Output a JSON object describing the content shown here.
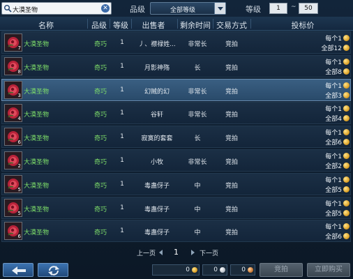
{
  "filters": {
    "search_value": "大漠圣物",
    "grade_label": "品级",
    "grade_value": "全部等级",
    "level_label": "等级",
    "level_min": "1",
    "level_sep": "~",
    "level_max": "50"
  },
  "columns": [
    "名称",
    "品级",
    "等级",
    "出售者",
    "剩余时间",
    "交易方式",
    "投标价"
  ],
  "rows": [
    {
      "qty": "7",
      "name": "大漠圣物",
      "grade": "奇巧",
      "level": "1",
      "seller": "丿、襟禄姓...",
      "time": "非常长",
      "trade": "竞拍",
      "each": "每个1",
      "total": "全部12",
      "selected": false
    },
    {
      "qty": "8",
      "name": "大漠圣物",
      "grade": "奇巧",
      "level": "1",
      "seller": "月影神殇",
      "time": "长",
      "trade": "竞拍",
      "each": "每个1",
      "total": "全部8",
      "selected": false
    },
    {
      "qty": "3",
      "name": "大漠圣物",
      "grade": "奇巧",
      "level": "1",
      "seller": "幻贼的幻",
      "time": "非常长",
      "trade": "竞拍",
      "each": "每个1",
      "total": "全部3",
      "selected": true
    },
    {
      "qty": "4",
      "name": "大漠圣物",
      "grade": "奇巧",
      "level": "1",
      "seller": "谷轩",
      "time": "非常长",
      "trade": "竞拍",
      "each": "每个1",
      "total": "全部4",
      "selected": false
    },
    {
      "qty": "6",
      "name": "大漠圣物",
      "grade": "奇巧",
      "level": "1",
      "seller": "寂寞的套套",
      "time": "长",
      "trade": "竞拍",
      "each": "每个1",
      "total": "全部6",
      "selected": false
    },
    {
      "qty": "2",
      "name": "大漠圣物",
      "grade": "奇巧",
      "level": "1",
      "seller": "小牧",
      "time": "非常长",
      "trade": "竞拍",
      "each": "每个1",
      "total": "全部2",
      "selected": false
    },
    {
      "qty": "5",
      "name": "大漠圣物",
      "grade": "奇巧",
      "level": "1",
      "seller": "毒蛊伢子",
      "time": "中",
      "trade": "竞拍",
      "each": "每个1",
      "total": "全部5",
      "selected": false
    },
    {
      "qty": "5",
      "name": "大漠圣物",
      "grade": "奇巧",
      "level": "1",
      "seller": "毒蛊伢子",
      "time": "中",
      "trade": "竞拍",
      "each": "每个1",
      "total": "全部5",
      "selected": false
    },
    {
      "qty": "6",
      "name": "大漠圣物",
      "grade": "奇巧",
      "level": "1",
      "seller": "毒蛊伢子",
      "time": "中",
      "trade": "竞拍",
      "each": "每个1",
      "total": "全部6",
      "selected": false
    }
  ],
  "pagination": {
    "prev_label": "上一页",
    "page": "1",
    "next_label": "下一页"
  },
  "bottom": {
    "back_icon": "arrow-left-icon",
    "refresh_icon": "refresh-icon",
    "gold": "0",
    "silver": "0",
    "copper": "0",
    "bid_label": "竞拍",
    "buyout_label": "立即购买"
  },
  "colors": {
    "item_name": "#7fe06a",
    "selected_row": "#3a5f82",
    "accent_button": "#3c73b0"
  }
}
